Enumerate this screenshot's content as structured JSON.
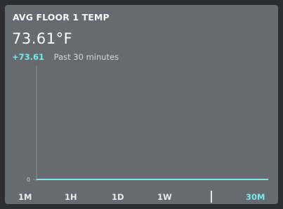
{
  "widget": {
    "title": "AVG FLOOR 1 TEMP",
    "value": "73.61°F",
    "delta": "+73.61",
    "period": "Past 30 minutes"
  },
  "chart_data": {
    "type": "line",
    "y_ticks": [
      "0"
    ],
    "x": [
      0,
      1
    ],
    "series": [
      {
        "values": [
          0,
          0
        ]
      }
    ],
    "ylim": [
      0,
      1
    ],
    "grid": false
  },
  "ranges": [
    {
      "label": "1M",
      "active": false
    },
    {
      "label": "1H",
      "active": false
    },
    {
      "label": "1D",
      "active": false
    },
    {
      "label": "1W",
      "active": false
    },
    {
      "label": "30M",
      "active": true
    }
  ],
  "colors": {
    "accent": "#7de6e6",
    "card": "#666b71",
    "background": "#2c2e31"
  }
}
